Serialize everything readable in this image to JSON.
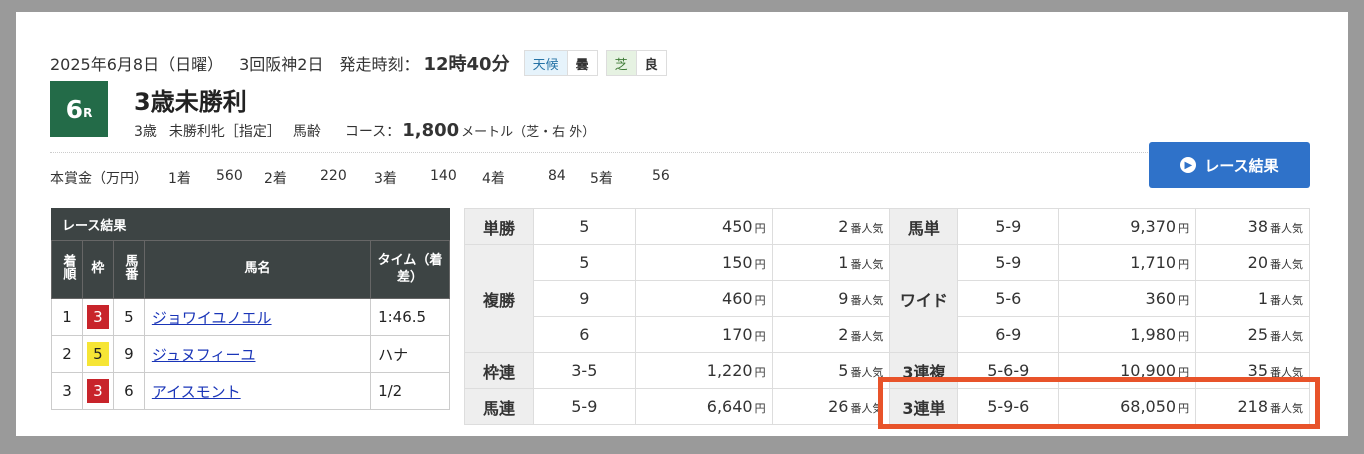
{
  "race": {
    "date": "2025年6月8日（日曜）",
    "meeting": "3回阪神2日",
    "start_label": "発走時刻：",
    "start_time": "12時40分",
    "weather_label": "天候",
    "weather": "曇",
    "ground_label": "芝",
    "ground": "良",
    "number": "6",
    "number_suffix": "R",
    "title": "3歳未勝利",
    "age": "3歳",
    "condition": "未勝利牝［指定］",
    "weight": "馬齢",
    "course_label": "コース：",
    "distance": "1,800",
    "distance_unit": "メートル（芝・右 外）"
  },
  "prize": {
    "label": "本賞金（万円）",
    "items": [
      {
        "place": "1着",
        "amount": "560"
      },
      {
        "place": "2着",
        "amount": "220"
      },
      {
        "place": "3着",
        "amount": "140"
      },
      {
        "place": "4着",
        "amount": "84"
      },
      {
        "place": "5着",
        "amount": "56"
      }
    ]
  },
  "result_button": "レース結果",
  "results": {
    "caption": "レース結果",
    "headers": {
      "rank": "着順",
      "waku": "枠",
      "num": "馬番",
      "name": "馬名",
      "time": "タイム（着差）"
    },
    "rows": [
      {
        "rank": "1",
        "waku": "3",
        "num": "5",
        "name": "ジョワイユノエル",
        "time": "1:46.5"
      },
      {
        "rank": "2",
        "waku": "5",
        "num": "9",
        "name": "ジュヌフィーユ",
        "time": "ハナ"
      },
      {
        "rank": "3",
        "waku": "3",
        "num": "6",
        "name": "アイスモント",
        "time": "1/2"
      }
    ]
  },
  "payouts": {
    "yen": "円",
    "ninki": "番人気",
    "tansho": {
      "label": "単勝",
      "combo": "5",
      "amount": "450",
      "pop": "2"
    },
    "fukusho": {
      "label": "複勝",
      "rows": [
        {
          "combo": "5",
          "amount": "150",
          "pop": "1"
        },
        {
          "combo": "9",
          "amount": "460",
          "pop": "9"
        },
        {
          "combo": "6",
          "amount": "170",
          "pop": "2"
        }
      ]
    },
    "wakuren": {
      "label": "枠連",
      "combo": "3-5",
      "amount": "1,220",
      "pop": "5"
    },
    "umaren": {
      "label": "馬連",
      "combo": "5-9",
      "amount": "6,640",
      "pop": "26"
    },
    "umatan": {
      "label": "馬単",
      "combo": "5-9",
      "amount": "9,370",
      "pop": "38"
    },
    "wide": {
      "label": "ワイド",
      "rows": [
        {
          "combo": "5-9",
          "amount": "1,710",
          "pop": "20"
        },
        {
          "combo": "5-6",
          "amount": "360",
          "pop": "1"
        },
        {
          "combo": "6-9",
          "amount": "1,980",
          "pop": "25"
        }
      ]
    },
    "sanrenpuku": {
      "label": "3連複",
      "combo": "5-6-9",
      "amount": "10,900",
      "pop": "35"
    },
    "sanrentan": {
      "label": "3連単",
      "combo": "5-9-6",
      "amount": "68,050",
      "pop": "218"
    }
  }
}
